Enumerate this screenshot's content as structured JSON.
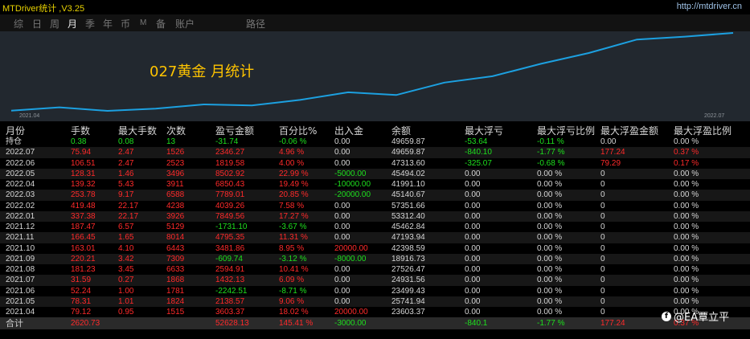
{
  "app": {
    "title": "MTDriver统计 ,V3.25",
    "link": "http://mtdriver.cn"
  },
  "tabs": [
    "综",
    "日",
    "周",
    "月",
    "季",
    "年",
    "币",
    "M",
    "备",
    "账户",
    "路径"
  ],
  "active_tab": "月",
  "chart_data": {
    "type": "line",
    "title": "027黄金 月统计",
    "x": [
      "2021.04",
      "2021.05",
      "2021.06",
      "2021.07",
      "2021.08",
      "2021.09",
      "2021.10",
      "2021.11",
      "2021.12",
      "2022.01",
      "2022.02",
      "2022.03",
      "2022.04",
      "2022.05",
      "2022.06",
      "2022.07"
    ],
    "x_tick_labels": [
      "2021.04",
      "2022.07"
    ],
    "series": [
      {
        "values": [
          3603.37,
          5742.0,
          3499.6,
          4931.8,
          7526.4,
          6916.8,
          10398.2,
          15193.6,
          13462.5,
          21312.4,
          25351.7,
          33140.6,
          39991.1,
          48494.0,
          50313.6,
          52628.13
        ]
      }
    ],
    "grid": false,
    "line_color": "#1ca0e0"
  },
  "table": {
    "headers": [
      "月份",
      "手数",
      "最大手数",
      "次数",
      "盈亏金额",
      "百分比%",
      "出入金",
      "余额",
      "最大浮亏",
      "最大浮亏比例",
      "最大浮盈金额",
      "最大浮盈比例"
    ],
    "rows": [
      [
        "持仓",
        "0.38",
        "0.08",
        "13",
        "-31.74",
        "-0.06 %",
        "0.00",
        "49659.87",
        "-53.64",
        "-0.11 %",
        "0.00",
        "0.00 %"
      ],
      [
        "2022.07",
        "75.94",
        "2.47",
        "1526",
        "2346.27",
        "4.96 %",
        "0.00",
        "49659.87",
        "-840.10",
        "-1.77 %",
        "177.24",
        "0.37 %"
      ],
      [
        "2022.06",
        "106.51",
        "2.47",
        "2523",
        "1819.58",
        "4.00 %",
        "0.00",
        "47313.60",
        "-325.07",
        "-0.68 %",
        "79.29",
        "0.17 %"
      ],
      [
        "2022.05",
        "128.31",
        "1.46",
        "3496",
        "8502.92",
        "22.99 %",
        "-5000.00",
        "45494.02",
        "0.00",
        "0.00 %",
        "0",
        "0.00 %"
      ],
      [
        "2022.04",
        "139.32",
        "5.43",
        "3911",
        "6850.43",
        "19.49 %",
        "-10000.00",
        "41991.10",
        "0.00",
        "0.00 %",
        "0",
        "0.00 %"
      ],
      [
        "2022.03",
        "253.78",
        "9.17",
        "6588",
        "7789.01",
        "20.85 %",
        "-20000.00",
        "45140.67",
        "0.00",
        "0.00 %",
        "0",
        "0.00 %"
      ],
      [
        "2022.02",
        "419.48",
        "22.17",
        "4238",
        "4039.26",
        "7.58 %",
        "0.00",
        "57351.66",
        "0.00",
        "0.00 %",
        "0",
        "0.00 %"
      ],
      [
        "2022.01",
        "337.38",
        "22.17",
        "3926",
        "7849.56",
        "17.27 %",
        "0.00",
        "53312.40",
        "0.00",
        "0.00 %",
        "0",
        "0.00 %"
      ],
      [
        "2021.12",
        "187.47",
        "6.57",
        "5129",
        "-1731.10",
        "-3.67 %",
        "0.00",
        "45462.84",
        "0.00",
        "0.00 %",
        "0",
        "0.00 %"
      ],
      [
        "2021.11",
        "166.45",
        "1.65",
        "8014",
        "4795.35",
        "11.31 %",
        "0.00",
        "47193.94",
        "0.00",
        "0.00 %",
        "0",
        "0.00 %"
      ],
      [
        "2021.10",
        "163.01",
        "4.10",
        "6443",
        "3481.86",
        "8.95 %",
        "20000.00",
        "42398.59",
        "0.00",
        "0.00 %",
        "0",
        "0.00 %"
      ],
      [
        "2021.09",
        "220.21",
        "3.42",
        "7309",
        "-609.74",
        "-3.12 %",
        "-8000.00",
        "18916.73",
        "0.00",
        "0.00 %",
        "0",
        "0.00 %"
      ],
      [
        "2021.08",
        "181.23",
        "3.45",
        "6633",
        "2594.91",
        "10.41 %",
        "0.00",
        "27526.47",
        "0.00",
        "0.00 %",
        "0",
        "0.00 %"
      ],
      [
        "2021.07",
        "31.59",
        "0.27",
        "1868",
        "1432.13",
        "6.09 %",
        "0.00",
        "24931.56",
        "0.00",
        "0.00 %",
        "0",
        "0.00 %"
      ],
      [
        "2021.06",
        "52.24",
        "1.00",
        "1781",
        "-2242.51",
        "-8.71 %",
        "0.00",
        "23499.43",
        "0.00",
        "0.00 %",
        "0",
        "0.00 %"
      ],
      [
        "2021.05",
        "78.31",
        "1.01",
        "1824",
        "2138.57",
        "9.06 %",
        "0.00",
        "25741.94",
        "0.00",
        "0.00 %",
        "0",
        "0.00 %"
      ],
      [
        "2021.04",
        "79.12",
        "0.95",
        "1515",
        "3603.37",
        "18.02 %",
        "20000.00",
        "23603.37",
        "0.00",
        "0.00 %",
        "0",
        "0.00 %"
      ]
    ],
    "total": [
      "合计",
      "2620.73",
      "",
      "",
      "52628.13",
      "145.41 %",
      "-3000.00",
      "",
      "-840.1",
      "-1.77 %",
      "177.24",
      "0.37 %"
    ]
  },
  "watermark": {
    "icon": "facebook-icon",
    "text": "@EA覃立平"
  },
  "colors": {
    "positive": "#ff2a2a",
    "negative": "#1ee01e",
    "title": "#ffc400"
  }
}
